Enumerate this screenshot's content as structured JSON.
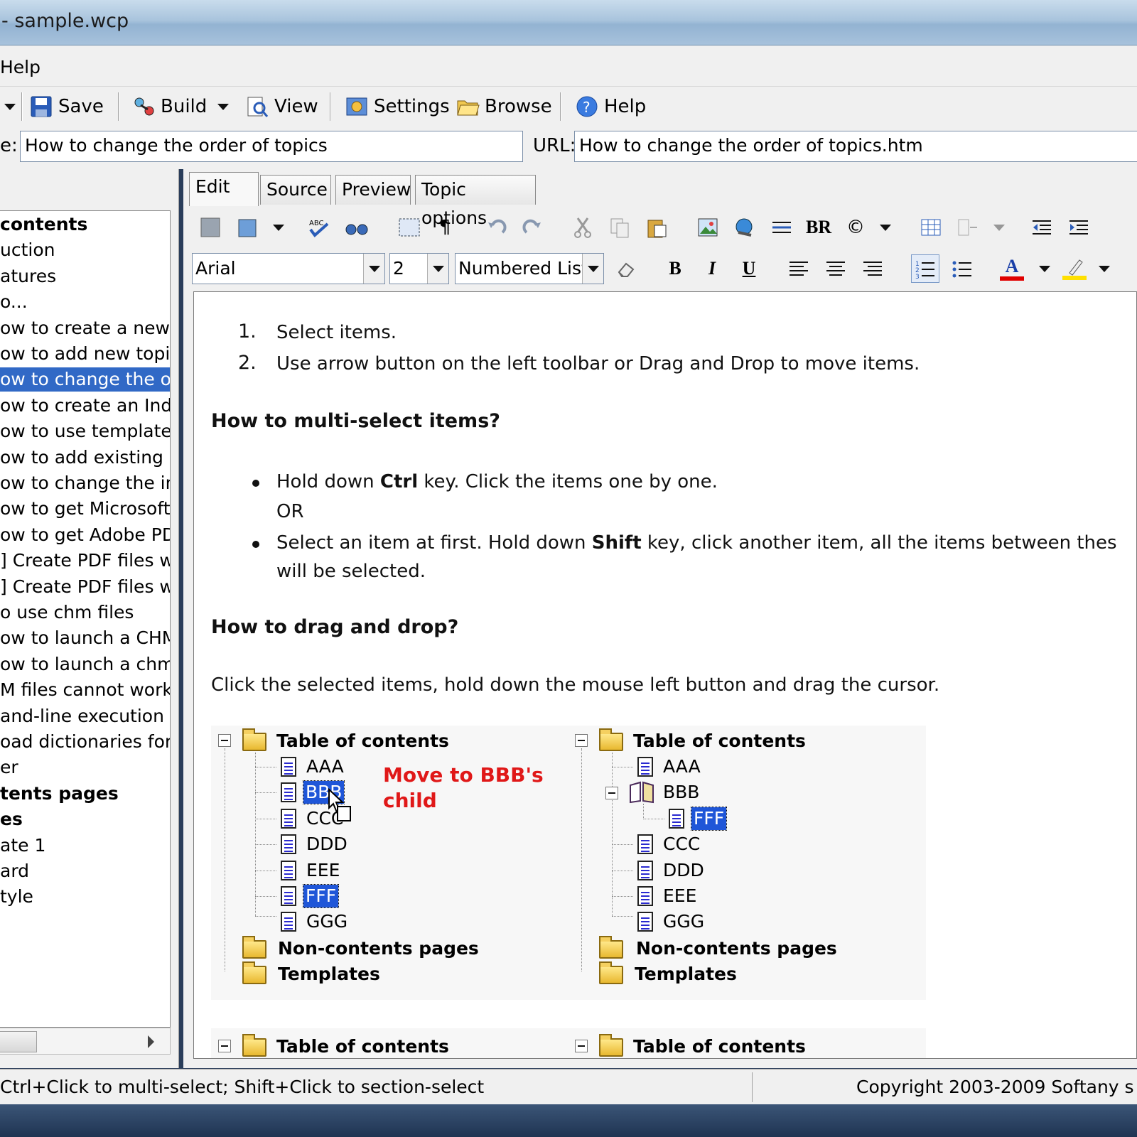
{
  "window": {
    "title": "- sample.wcp"
  },
  "menu": {
    "help": "Help"
  },
  "toolbar": {
    "save": "Save",
    "build": "Build",
    "view": "View",
    "settings": "Settings",
    "browse": "Browse",
    "help": "Help"
  },
  "fields": {
    "title_label": "e:",
    "title_value": "How to change the order of topics",
    "url_label": "URL:",
    "url_value": "How to change the order of topics.htm"
  },
  "left_tree": {
    "items": [
      {
        "label": "contents",
        "bold": true
      },
      {
        "label": "uction"
      },
      {
        "label": "atures"
      },
      {
        "label": "o..."
      },
      {
        "label": "ow to create a new pro"
      },
      {
        "label": "ow to add new topics in"
      },
      {
        "label": "ow to change the orde",
        "selected": true
      },
      {
        "label": "ow to create an Index"
      },
      {
        "label": "ow to use templates"
      },
      {
        "label": "ow to add existing html"
      },
      {
        "label": "ow to change the interf"
      },
      {
        "label": "ow to get Microsoft Wo"
      },
      {
        "label": "ow to get Adobe PDF f"
      },
      {
        "label": "] Create PDF files with"
      },
      {
        "label": "] Create PDF files with"
      },
      {
        "label": "o use chm files"
      },
      {
        "label": "ow to launch a CHM fil"
      },
      {
        "label": "ow to launch a chm file"
      },
      {
        "label": "M files cannot work"
      },
      {
        "label": "and-line execution"
      },
      {
        "label": "oad dictionaries for spe"
      },
      {
        "label": "er"
      },
      {
        "label": "tents pages",
        "bold": true
      },
      {
        "label": "es",
        "bold": true
      },
      {
        "label": "ate 1"
      },
      {
        "label": "ard"
      },
      {
        "label": "tyle"
      }
    ]
  },
  "tabs": [
    "Edit",
    "Source",
    "Preview",
    "Topic options"
  ],
  "editor_toolbar": {
    "br": "BR",
    "copyright": "©",
    "font": "Arial",
    "size": "2",
    "style": "Numbered List",
    "bold": "B",
    "italic": "I",
    "underline": "U",
    "pilcrow": "¶",
    "font_color": "A"
  },
  "document": {
    "list1": [
      {
        "num": "1.",
        "text": "Select items."
      },
      {
        "num": "2.",
        "text": "Use arrow button on the left toolbar or Drag and Drop to move items."
      }
    ],
    "heading1": "How to multi-select items?",
    "bullet1_pre": "Hold down ",
    "bullet1_key": "Ctrl",
    "bullet1_post": " key. Click the items one by one.",
    "or": "OR",
    "bullet2_pre": "Select an item at first. Hold down ",
    "bullet2_key": "Shift",
    "bullet2_post": " key, click another item, all the items between thes",
    "bullet2_line2": "will be selected.",
    "heading2": "How to drag and drop?",
    "para": "Click the selected items, hold down the mouse left button and drag the cursor.",
    "note": "Move to BBB's child",
    "tree_root": "Table of contents",
    "tree_left": [
      "AAA",
      "BBB",
      "CCC",
      "DDD",
      "EEE",
      "FFF",
      "GGG"
    ],
    "tree_right_top": [
      "AAA",
      "BBB"
    ],
    "tree_right_child": "FFF",
    "tree_right_rest": [
      "CCC",
      "DDD",
      "EEE",
      "GGG"
    ],
    "non_contents": "Non-contents pages",
    "templates": "Templates"
  },
  "status": {
    "left": "Ctrl+Click to multi-select; Shift+Click to section-select",
    "right": "Copyright 2003-2009 Softany s"
  }
}
